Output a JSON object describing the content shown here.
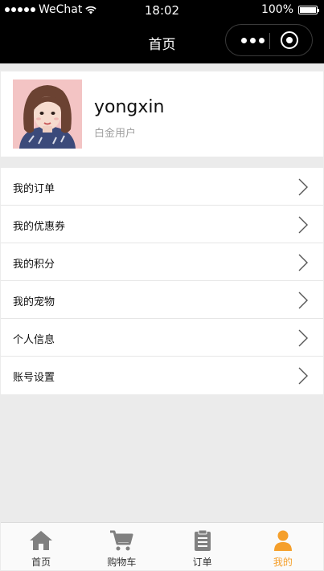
{
  "status_bar": {
    "carrier": "WeChat",
    "time": "18:02",
    "battery": "100%"
  },
  "nav": {
    "title": "首页"
  },
  "profile": {
    "username": "yongxin",
    "level": "白金用户"
  },
  "menu": {
    "items": [
      {
        "label": "我的订单"
      },
      {
        "label": "我的优惠券"
      },
      {
        "label": "我的积分"
      },
      {
        "label": "我的宠物"
      },
      {
        "label": "个人信息"
      },
      {
        "label": "账号设置"
      }
    ]
  },
  "tabbar": {
    "items": [
      {
        "label": "首页",
        "icon": "home-icon"
      },
      {
        "label": "购物车",
        "icon": "cart-icon"
      },
      {
        "label": "订单",
        "icon": "clipboard-icon"
      },
      {
        "label": "我的",
        "icon": "person-icon"
      }
    ],
    "active_index": 3,
    "active_color": "#f59f2b",
    "inactive_color": "#808080"
  }
}
